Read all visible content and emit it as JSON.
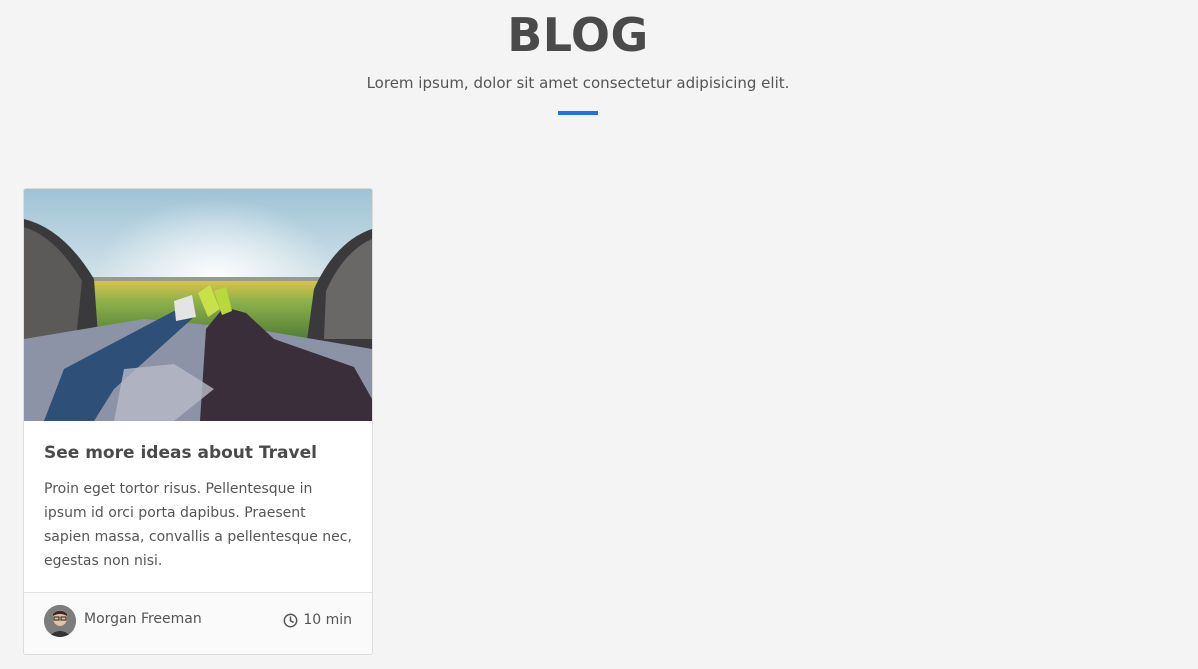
{
  "header": {
    "title": "BLOG",
    "subtitle": "Lorem ipsum, dolor sit amet consectetur adipisicing elit.",
    "accent_color": "#1a73e8"
  },
  "posts": [
    {
      "image": "photo of two people's legs with sneakers resting in an open car trunk facing a sunset over a yellow flower field",
      "title": "See more ideas about Travel",
      "excerpt": "Proin eget tortor risus. Pellentesque in ipsum id orci porta dapibus. Praesent sapien massa, convallis a pellentesque nec, egestas non nisi.",
      "author": "Morgan Freeman",
      "read_time": "10 min",
      "icons": {
        "avatar": "avatar",
        "time": "clock-icon"
      }
    }
  ]
}
